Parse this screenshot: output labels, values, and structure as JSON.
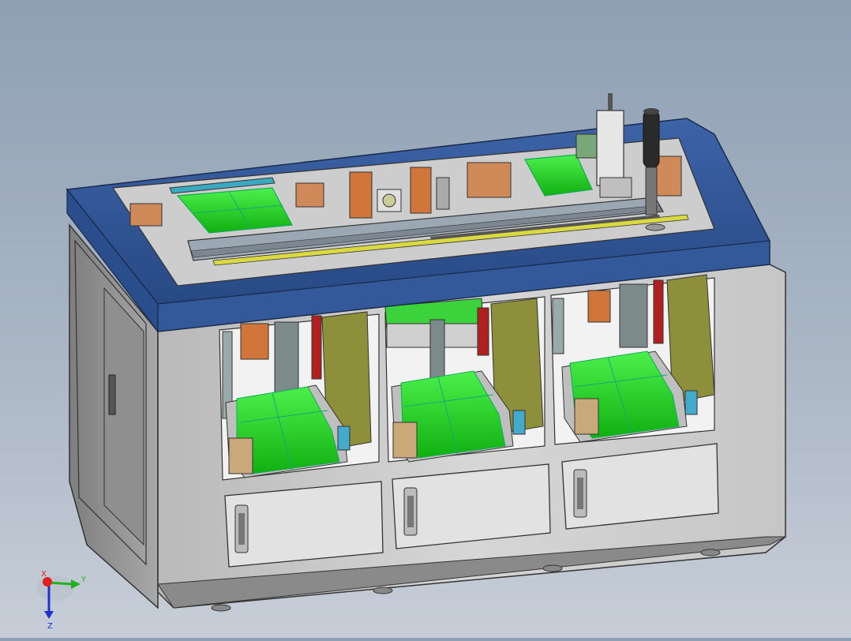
{
  "viewport": {
    "background_top": "#8ea0b4",
    "background_bottom": "#c7ced8"
  },
  "machine": {
    "top_frame_color": "#2e5190",
    "body_color": "#d0d0d0",
    "pcb_color": "#22dd22",
    "copper_color": "#d88a50",
    "bays": 3
  },
  "triad": {
    "x_label": "X",
    "y_label": "Y",
    "z_label": "Z",
    "x_color": "#e02020",
    "y_color": "#20b020",
    "z_color": "#2030d0"
  }
}
